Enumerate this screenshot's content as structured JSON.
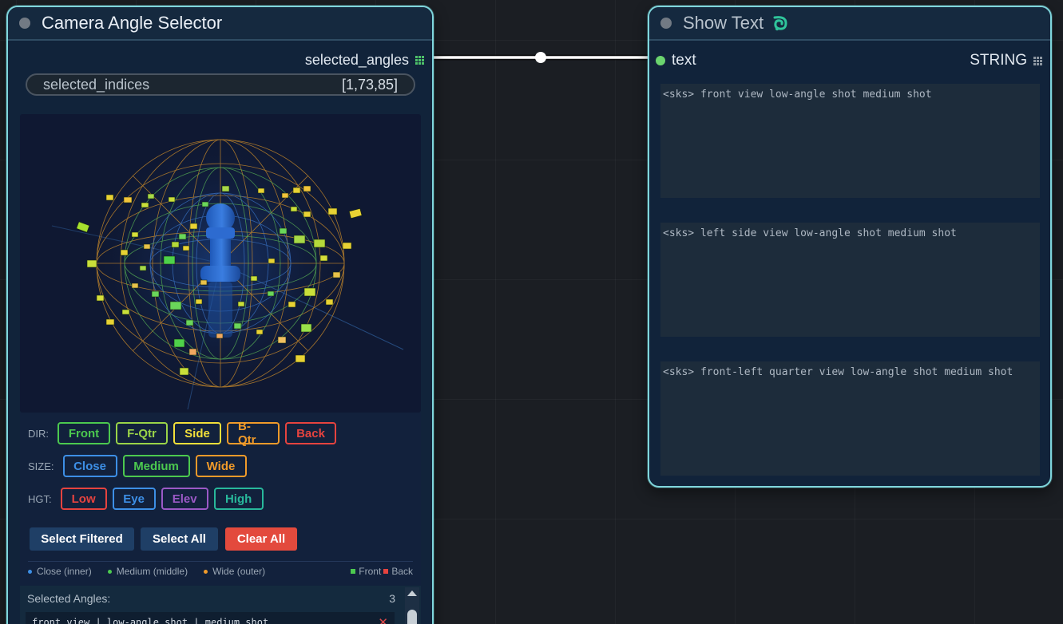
{
  "camera_node": {
    "title": "Camera Angle Selector",
    "output_label": "selected_angles",
    "widget": {
      "name": "selected_indices",
      "value": "[1,73,85]"
    },
    "filters": {
      "dir": {
        "label": "DIR:",
        "buttons": [
          {
            "label": "Front",
            "color": "#4cc94f"
          },
          {
            "label": "F-Qtr",
            "color": "#9ad448"
          },
          {
            "label": "Side",
            "color": "#f2df3a"
          },
          {
            "label": "B-Qtr",
            "color": "#f09a2a"
          },
          {
            "label": "Back",
            "color": "#e6433f"
          }
        ]
      },
      "size": {
        "label": "SIZE:",
        "buttons": [
          {
            "label": "Close",
            "color": "#3d8fe6"
          },
          {
            "label": "Medium",
            "color": "#4cc94f"
          },
          {
            "label": "Wide",
            "color": "#f09a2a"
          }
        ]
      },
      "hgt": {
        "label": "HGT:",
        "buttons": [
          {
            "label": "Low",
            "color": "#e6433f"
          },
          {
            "label": "Eye",
            "color": "#3d8fe6"
          },
          {
            "label": "Elev",
            "color": "#9b59c6"
          },
          {
            "label": "High",
            "color": "#28b89b"
          }
        ]
      }
    },
    "actions": {
      "select_filtered": "Select Filtered",
      "select_all": "Select All",
      "clear_all": "Clear All"
    },
    "legend": {
      "close": "Close (inner)",
      "medium": "Medium (middle)",
      "wide": "Wide (outer)",
      "front": "Front",
      "back": "Back"
    },
    "selected": {
      "header": "Selected Angles:",
      "count": "3",
      "items": [
        "front view | low-angle shot | medium shot"
      ]
    }
  },
  "show_text_node": {
    "title": "Show Text",
    "input_label": "text",
    "input_type": "STRING",
    "texts": [
      "<sks> front view low-angle shot medium shot",
      "<sks> left side view low-angle shot medium shot",
      "<sks> front-left quarter view low-angle shot medium shot"
    ]
  },
  "colors": {
    "node_border": "#7fd6dc",
    "node_bg": "#11233a",
    "canvas_bg": "#1b1e23",
    "select_button_bg": "#1f3f66",
    "clear_button_bg": "#e34a3d",
    "slot_green": "#6bd46e"
  },
  "icons": {
    "collapse": "circle-dot-icon",
    "output_grid": "grid-icon",
    "show_text_badge": "swirl-badge-icon",
    "remove": "close-icon",
    "scroll_up": "chevron-up-icon"
  }
}
